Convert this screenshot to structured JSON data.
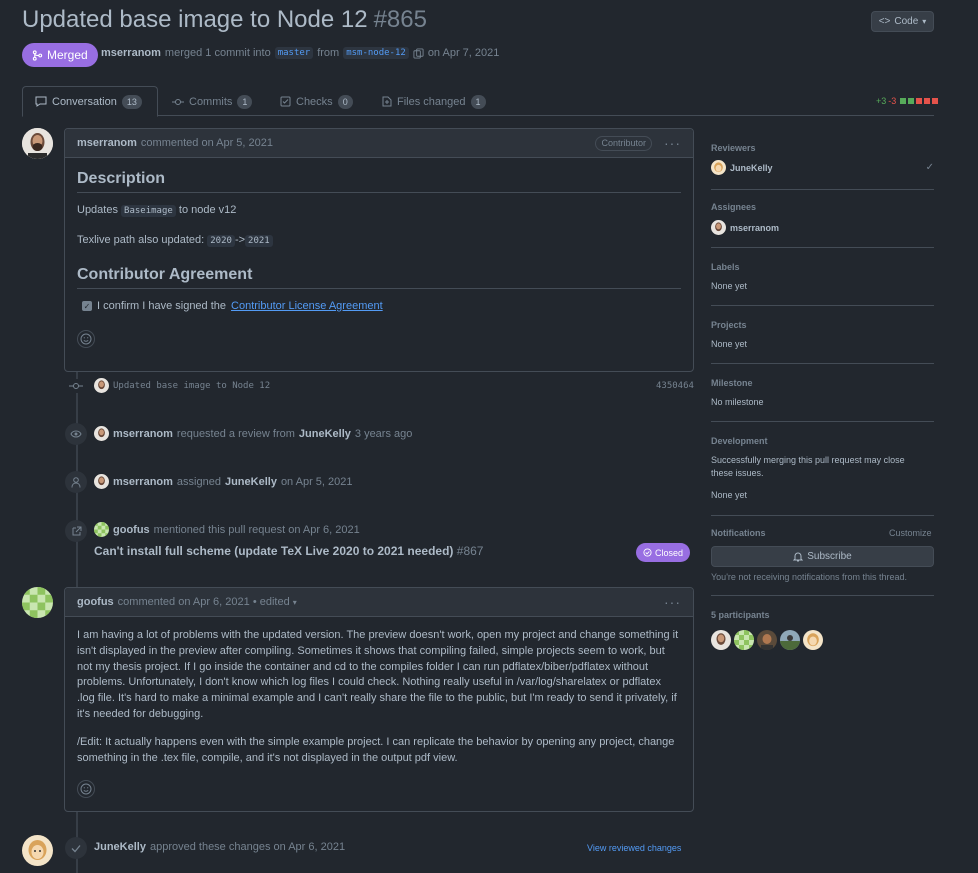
{
  "pr": {
    "title": "Updated base image to Node 12",
    "number": "#865",
    "code_button": "Code",
    "status": "Merged",
    "author": "mserranom",
    "meta_merged": "merged 1 commit into",
    "base_branch": "master",
    "meta_from": "from",
    "head_branch": "msm-node-12",
    "meta_date": "on Apr 7, 2021"
  },
  "tabs": [
    {
      "label": "Conversation",
      "count": "13"
    },
    {
      "label": "Commits",
      "count": "1"
    },
    {
      "label": "Checks",
      "count": "0"
    },
    {
      "label": "Files changed",
      "count": "1"
    }
  ],
  "diffstat": {
    "added": "+3",
    "removed": "-3"
  },
  "comment1": {
    "author": "mserranom",
    "meta": "commented on Apr 5, 2021",
    "badge": "Contributor",
    "heading1": "Description",
    "line1_pre": "Updates",
    "line1_code": "Baseimage",
    "line1_post": "to node v12",
    "line2_pre": "Texlive path also updated:",
    "line2_code1": "2020",
    "line2_arrow": "->",
    "line2_code2": "2021",
    "heading2": "Contributor Agreement",
    "checkbox_text": "I confirm I have signed the",
    "checkbox_link": "Contributor License Agreement"
  },
  "events": {
    "commit_msg": "Updated base image to Node 12",
    "commit_sha": "4350464",
    "review_actor": "mserranom",
    "review_text": "requested a review from",
    "review_target": "JuneKelly",
    "review_time": "3 years ago",
    "assign_actor": "mserranom",
    "assign_text": "assigned",
    "assign_target": "JuneKelly",
    "assign_time": "on Apr 5, 2021",
    "mention_actor": "goofus",
    "mention_text": "mentioned this pull request on Apr 6, 2021",
    "mention_title": "Can't install full scheme (update TeX Live 2020 to 2021 needed)",
    "mention_num": "#867",
    "mention_status": "Closed",
    "approve_actor": "JuneKelly",
    "approve_text": "approved these changes on Apr 6, 2021",
    "approve_link": "View reviewed changes"
  },
  "comment2": {
    "author": "goofus",
    "meta": "commented on Apr 6, 2021 • edited",
    "para1": "I am having a lot of problems with the updated version. The preview doesn't work, open my project and change something it isn't displayed in the preview after compiling. Sometimes it shows that compiling failed, simple projects seem to work, but not my thesis project. If I go inside the container and cd to the compiles folder I can run pdflatex/biber/pdflatex without problems. Unfortunately, I don't know which log files I could check. Nothing really useful in /var/log/sharelatex or pdflatex .log file. It's hard to make a minimal example and I can't really share the file to the public, but I'm ready to send it privately, if it's needed for debugging.",
    "para2": "/Edit: It actually happens even with the simple example project. I can replicate the behavior by opening any project, change something in the .tex file, compile, and it's not displayed in the output pdf view."
  },
  "sidebar": {
    "reviewers_h": "Reviewers",
    "reviewer": "JuneKelly",
    "assignees_h": "Assignees",
    "assignee": "mserranom",
    "labels_h": "Labels",
    "labels_v": "None yet",
    "projects_h": "Projects",
    "projects_v": "None yet",
    "milestone_h": "Milestone",
    "milestone_v": "No milestone",
    "development_h": "Development",
    "development_text": "Successfully merging this pull request may close these issues.",
    "development_v": "None yet",
    "notifications_h": "Notifications",
    "customize": "Customize",
    "subscribe": "Subscribe",
    "notif_text": "You're not receiving notifications from this thread.",
    "participants_h": "5 participants"
  }
}
